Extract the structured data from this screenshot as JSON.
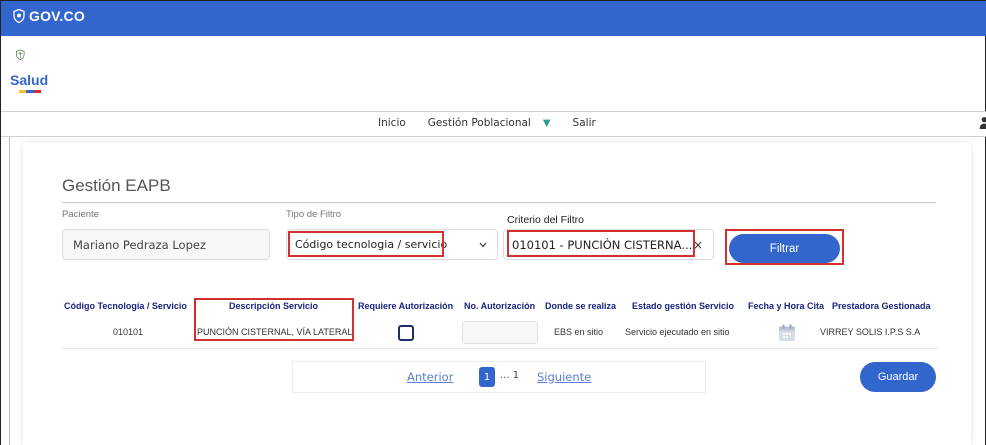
{
  "gov_bar": {
    "brand": "GOV.CO",
    "color": "#3366cc"
  },
  "logo": {
    "text": "Salud",
    "colors": [
      "#f4c430",
      "#3366cc",
      "#d32f2f"
    ]
  },
  "nav": {
    "items": [
      "Inicio",
      "Gestión Poblacional",
      "Salir"
    ],
    "dropdown_icon": "triangle-down-icon"
  },
  "page": {
    "title": "Gestión EAPB"
  },
  "filters": {
    "paciente_label": "Paciente",
    "paciente_value": "Mariano  Pedraza Lopez",
    "tipo_label": "Tipo de Filtro",
    "tipo_value": "Código tecnologia / servicio",
    "criterio_label": "Criterio del Filtro",
    "criterio_value": "010101 - PUNCIÓN CISTERNA...",
    "clear_symbol": "×",
    "filtrar_label": "Filtrar"
  },
  "table": {
    "headers": [
      "Código Tecnología / Servicio",
      "Descripción Servicio",
      "Requiere Autorización",
      "No. Autorización",
      "Donde se realiza",
      "Estado gestión Servicio",
      "Fecha y Hora Cita",
      "Prestadora Gestionada"
    ],
    "rows": [
      {
        "codigo": "010101",
        "descripcion": "PUNCIÓN CISTERNAL, VÍA LATERAL",
        "requiere_autorizacion": false,
        "no_autorizacion": "",
        "donde": "EBS en sitio",
        "estado": "Servicio ejecutado en sitio",
        "fecha_icon": "calendar-icon",
        "prestadora": "VIRREY SOLIS I.P.S S.A"
      }
    ]
  },
  "pagination": {
    "prev": "Anterior",
    "current": "1",
    "dots": "... 1",
    "next": "Siguiente"
  },
  "actions": {
    "guardar": "Guardar"
  },
  "colors": {
    "primary": "#3366cc",
    "highlight": "#d32f2f",
    "header_text": "#1a237e",
    "link": "#5b7fd6"
  }
}
